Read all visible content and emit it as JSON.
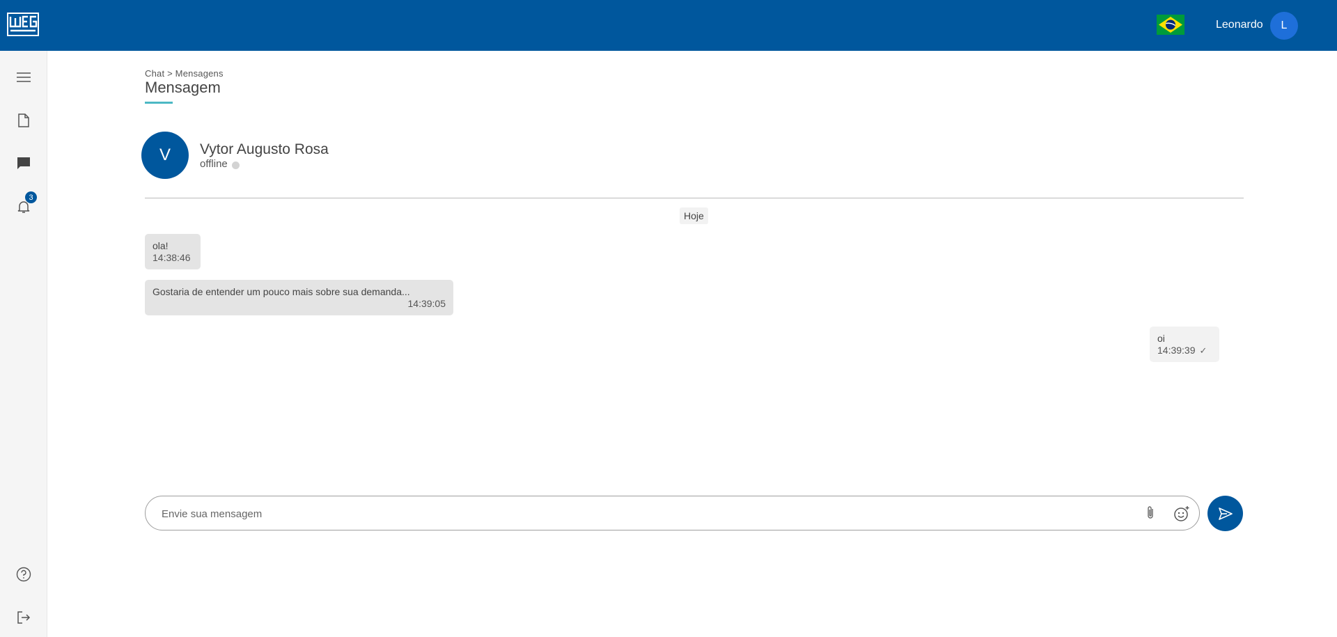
{
  "header": {
    "logo_text": "WEG",
    "user_name": "Leonardo",
    "user_initial": "L"
  },
  "sidebar": {
    "notifications_count": "3"
  },
  "breadcrumb": "Chat > Mensagens",
  "page_title": "Mensagem",
  "contact": {
    "initial": "V",
    "name": "Vytor Augusto Rosa",
    "status": "offline"
  },
  "day_label": "Hoje",
  "messages": [
    {
      "text": "ola!",
      "time": "14:38:46",
      "from": "contact"
    },
    {
      "text": "Gostaria de entender um pouco mais sobre sua demanda...",
      "time": "14:39:05",
      "from": "contact"
    },
    {
      "text": "oi",
      "time": "14:39:39",
      "from": "me",
      "status": "sent"
    }
  ],
  "composer": {
    "placeholder": "Envie sua mensagem",
    "value": ""
  },
  "colors": {
    "brand": "#00579d",
    "accent_underline": "#4cb8c4",
    "user_avatar": "#1e6fd9"
  }
}
